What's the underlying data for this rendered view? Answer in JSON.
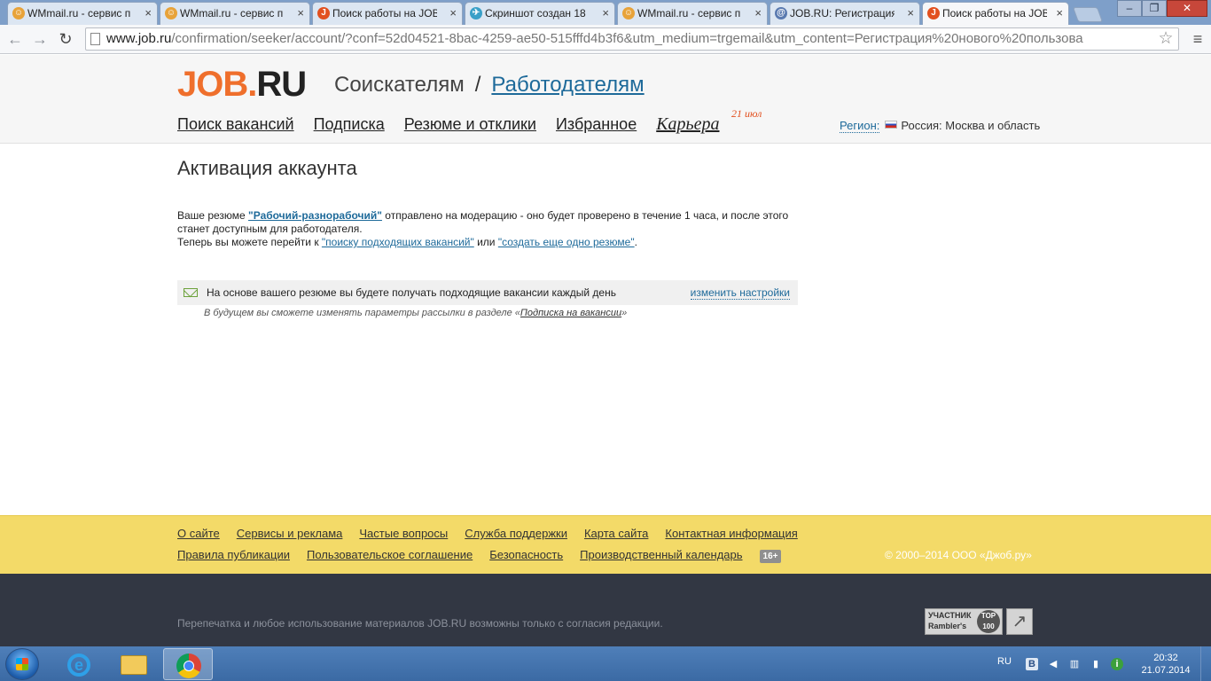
{
  "browser": {
    "tabs": [
      {
        "label": "WMmail.ru - сервис п",
        "icon": "wmmail-icon",
        "color": "#e8a33a"
      },
      {
        "label": "WMmail.ru - сервис п",
        "icon": "wmmail-icon",
        "color": "#e8a33a"
      },
      {
        "label": "Поиск работы на JOB",
        "icon": "job-icon",
        "color": "#e2501f"
      },
      {
        "label": "Скриншот создан 18",
        "icon": "screenshot-icon",
        "color": "#3aa0c8"
      },
      {
        "label": "WMmail.ru - сервис п",
        "icon": "wmmail-icon",
        "color": "#e8a33a"
      },
      {
        "label": "JOB.RU: Регистрация",
        "icon": "mail-at-icon",
        "color": "#5a7ab0"
      },
      {
        "label": "Поиск работы на JOB",
        "icon": "job-icon",
        "color": "#e2501f"
      }
    ],
    "tab_close": "×",
    "url_host": "www.job.ru",
    "url_rest": "/confirmation/seeker/account/?conf=52d04521-8bac-4259-ae50-515fffd4b3f6&utm_medium=trgemail&utm_content=Регистрация%20нового%20пользова"
  },
  "site": {
    "logo_job": "JOB.",
    "logo_ru": "RU",
    "audience_seekers": "Соискателям",
    "audience_sep": "/",
    "audience_employers": "Работодателям",
    "nav": [
      "Поиск вакансий",
      "Подписка",
      "Резюме и отклики",
      "Избранное",
      "Карьера"
    ],
    "career_date": "21 июл",
    "region_label": "Регион:",
    "region_value": "Россия: Москва и область"
  },
  "content": {
    "title": "Активация аккаунта",
    "line1_pre": "Ваше резюме ",
    "resume_link": "\"Рабочий-разнорабочий\"",
    "line1_post": " отправлено на модерацию - оно будет проверено в течение 1 часа, и после этого станет доступным для работодателя.",
    "line2_pre": "Теперь вы можете перейти к ",
    "search_link": "\"поиску подходящих вакансий\"",
    "line2_mid": " или ",
    "create_link": "\"создать еще одно резюме\"",
    "line2_post": ".",
    "notice_text": "На основе вашего резюме вы будете получать подходящие вакансии каждый день",
    "notice_link": "изменить настройки",
    "hint_pre": "В будущем вы сможете изменять параметры рассылки в разделе «",
    "hint_link": "Подписка на вакансии",
    "hint_post": "»"
  },
  "footer": {
    "row1": [
      "О сайте",
      "Сервисы и реклама",
      "Частые вопросы",
      "Служба поддержки",
      "Карта сайта",
      "Контактная информация"
    ],
    "row2": [
      "Правила публикации",
      "Пользовательское соглашение",
      "Безопасность",
      "Производственный календарь"
    ],
    "age": "16+",
    "copyright": "© 2000–2014 ООО «Джоб.ру»",
    "reprint": "Перепечатка и любое использование материалов JOB.RU возможны только с согласия редакции.",
    "rambler_line1": "УЧАСТНИК",
    "rambler_line2": "Rambler's",
    "rambler_top": "TOP 100"
  },
  "taskbar": {
    "lang": "RU",
    "time": "20:32",
    "date": "21.07.2014"
  }
}
